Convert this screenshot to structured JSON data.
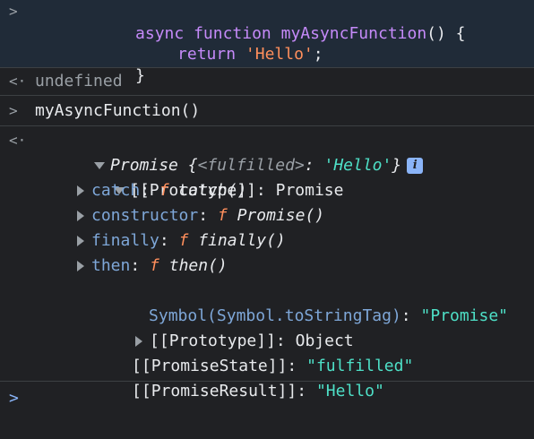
{
  "console": {
    "input1": {
      "gutter": ">",
      "line1": {
        "kw1": "async",
        "kw2": "function",
        "name": "myAsyncFunction",
        "rest": "() {"
      },
      "line2": {
        "kw": "return",
        "str": "'Hello'",
        "semi": ";"
      },
      "line3": {
        "brace": "}"
      }
    },
    "output1": {
      "gutter": "<·",
      "value": "undefined"
    },
    "input2": {
      "gutter": ">",
      "text": "myAsyncFunction()"
    },
    "output2": {
      "gutter": "<·",
      "summary": {
        "label": "Promise",
        "open": " {",
        "state": "<fulfilled>",
        "colon": ": ",
        "value": "'Hello'",
        "close": "}"
      },
      "info_icon": "i",
      "tree": {
        "prototype_label": "[[Prototype]]",
        "prototype_value": "Promise",
        "methods": [
          {
            "key": "catch",
            "f": "f",
            "sig": "catch()"
          },
          {
            "key": "constructor",
            "f": "f",
            "sig": "Promise()"
          },
          {
            "key": "finally",
            "f": "f",
            "sig": "finally()"
          },
          {
            "key": "then",
            "f": "f",
            "sig": "then()"
          }
        ],
        "symbol_key": "Symbol(Symbol.toStringTag)",
        "symbol_value": "\"Promise\"",
        "inner_prototype_label": "[[Prototype]]",
        "inner_prototype_value": "Object",
        "state_key": "[[PromiseState]]",
        "state_value": "\"fulfilled\"",
        "result_key": "[[PromiseResult]]",
        "result_value": "\"Hello\""
      }
    },
    "prompt": {
      "caret": ">"
    }
  },
  "colors": {
    "background": "#202124",
    "input_highlight": "#202b38",
    "keyword": "#c58af9",
    "string_single": "#ff8f5c",
    "string_double": "#4ee0c7",
    "property": "#7ea7d8",
    "info_badge": "#8ab4f8"
  }
}
